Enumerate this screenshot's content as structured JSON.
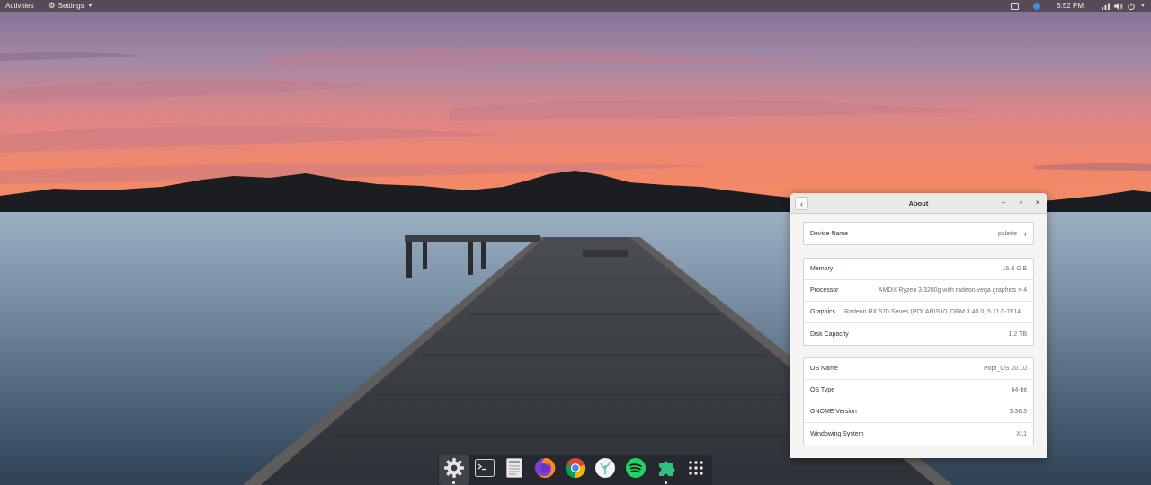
{
  "topbar": {
    "activities": "Activities",
    "app_menu": "Settings",
    "clock": "5:52 PM",
    "icons": [
      "tray-window-icon",
      "tray-app-icon",
      "network-icon",
      "volume-icon",
      "power-icon",
      "dropdown-arrow-icon"
    ]
  },
  "window": {
    "title": "About",
    "device": {
      "label": "Device Name",
      "value": "palette"
    },
    "hardware": [
      {
        "label": "Memory",
        "value": "15.6 GiB"
      },
      {
        "label": "Processor",
        "value": "AMD® Ryzen 3 3200g with radeon vega graphics × 4"
      },
      {
        "label": "Graphics",
        "value": "Radeon RX 570 Series (POLARIS10, DRM 3.40.0, 5.11.0-7614…"
      },
      {
        "label": "Disk Capacity",
        "value": "1.2 TB"
      }
    ],
    "software": [
      {
        "label": "OS Name",
        "value": "Pop!_OS 20.10"
      },
      {
        "label": "OS Type",
        "value": "64-bit"
      },
      {
        "label": "GNOME Version",
        "value": "3.38.3"
      },
      {
        "label": "Windowing System",
        "value": "X11"
      }
    ]
  },
  "dock": {
    "items": [
      {
        "name": "settings-icon",
        "running": true,
        "active": true
      },
      {
        "name": "terminal-icon",
        "running": false
      },
      {
        "name": "text-editor-icon",
        "running": false
      },
      {
        "name": "firefox-icon",
        "running": false
      },
      {
        "name": "chrome-icon",
        "running": false
      },
      {
        "name": "app-store-icon",
        "running": false
      },
      {
        "name": "spotify-icon",
        "running": false
      },
      {
        "name": "extensions-icon",
        "running": true
      },
      {
        "name": "app-grid-icon",
        "running": false
      }
    ]
  },
  "colors": {
    "topbar_bg": "#574a56",
    "window_bg": "#f6f5f4",
    "dock_bg": "#23262d",
    "accent_blue": "#3d8fe0"
  }
}
